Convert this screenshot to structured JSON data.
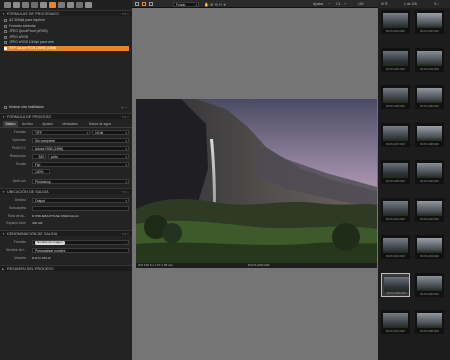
{
  "left_panel": {
    "toolbar_icon_colors": [
      "#7f7f7f",
      "#8b8b8b",
      "#7a7a7a",
      "#6d6d6d",
      "#8e8e8e",
      "#e8852c",
      "#7a7a7a",
      "#8a8a8a",
      "#6f6f6f",
      "#8e8e8e"
    ],
    "recipes_header": "FÓRMULAS DE PROCESADO",
    "recipes": [
      {
        "label": "A3 300dpi para imprimir",
        "selected": false
      },
      {
        "label": "Formato estándar",
        "selected": false
      },
      {
        "label": "JPEG QuickProof (sRGB)",
        "selected": false
      },
      {
        "label": "JPEG sRGB",
        "selected": false
      },
      {
        "label": "JPEG sRGB 100dpi para web",
        "selected": false
      },
      {
        "label": "TIFF Adobe RGB (1998) (16bit)",
        "selected": true
      }
    ],
    "show_enabled_only": "Mostrar sólo habilitados",
    "recipe_section_header": "FÓRMULA DE PROCESO",
    "recipe_tabs": [
      "Básico",
      "Archivo",
      "Ajustes",
      "Metadatos",
      "Marca de agua"
    ],
    "active_tab": "Básico",
    "format_label": "Formato",
    "format_value": "TIFF",
    "bits_value": "16 bit",
    "compression_label": "Opciones",
    "compression_value": "Sin comprimir",
    "icc_label": "Perfil ICC",
    "icc_value": "Adobe RGB (1998)",
    "resolution_label": "Resolución",
    "resolution_value": "300",
    "resolution_unit": "px/in",
    "scale_label": "Escala",
    "scale_value": "Fijo",
    "scale_percent": "100%",
    "open_with_label": "Abrir con",
    "open_with_value": "Photoshop",
    "location_header": "UBICACIÓN DE SALIDA",
    "destination_label": "Destino",
    "destination_value": "Output",
    "subfolder_label": "Subcarpeta",
    "root_path_label": "Ruta de Ac..",
    "root_path_value": "D:\\PRUEBA PHASE ONE\\Output\\",
    "free_space_label": "Espacio Libre",
    "free_space_value": "300 GB",
    "naming_header": "DENOMINACIÓN DE SALIDA",
    "naming_format_label": "Formato",
    "naming_format_value": "Nombre de imagen",
    "job_name_label": "Nombre de t..",
    "job_name_value": "Personalizar nombre",
    "sample_label": "Muestra",
    "sample_value": "D1171-045.tif",
    "summary_header": "RESUMEN DEL PROCESO"
  },
  "topbar": {
    "mode_select": "Fondo",
    "adjust_label": "Ajustar",
    "zoom_value": "1:1",
    "fit_value": "100"
  },
  "viewer": {
    "exif_caption": "ISO 100  6.1 s f/7.1  28 mm",
    "filename_caption": "D1171-045.CR2"
  },
  "browser": {
    "count_label": "1 de 126",
    "thumbnails": [
      {
        "name": "D1171-031.CR2",
        "sel": false
      },
      {
        "name": "D1171-032.CR2",
        "sel": false
      },
      {
        "name": "D1171-033.CR2",
        "sel": false
      },
      {
        "name": "D1171-034.CR2",
        "sel": false
      },
      {
        "name": "D1171-035.CR2",
        "sel": false
      },
      {
        "name": "D1171-036.CR2",
        "sel": false
      },
      {
        "name": "D1171-037.CR2",
        "sel": false
      },
      {
        "name": "D1171-038.CR2",
        "sel": false
      },
      {
        "name": "D1171-039.CR2",
        "sel": false
      },
      {
        "name": "D1171-040.CR2",
        "sel": false
      },
      {
        "name": "D1171-041.CR2",
        "sel": false
      },
      {
        "name": "D1171-042.CR2",
        "sel": false
      },
      {
        "name": "D1171-043.CR2",
        "sel": false
      },
      {
        "name": "D1171-044.CR2",
        "sel": false
      },
      {
        "name": "D1171-045.CR2",
        "sel": true
      },
      {
        "name": "D1171-046.CR2",
        "sel": false
      },
      {
        "name": "D1171-047.CR2",
        "sel": false
      },
      {
        "name": "D1171-048.CR2",
        "sel": false
      }
    ]
  }
}
